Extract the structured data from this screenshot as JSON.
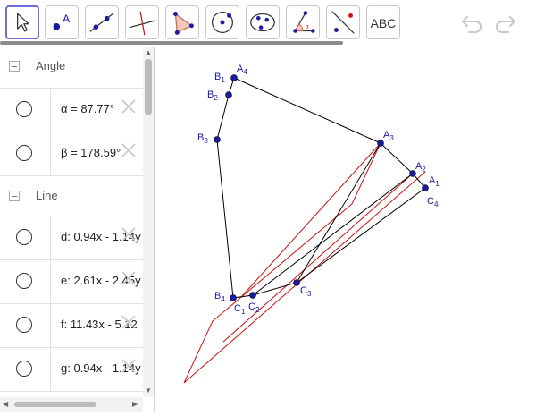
{
  "toolbar": {
    "abc_label": "ABC",
    "tools": [
      "move-tool",
      "point-tool",
      "line-tool",
      "perpendicular-tool",
      "polygon-tool",
      "circle-tool",
      "conic-tool",
      "angle-tool",
      "reflect-tool",
      "text-tool"
    ]
  },
  "algebra": {
    "groups": [
      {
        "label": "Angle"
      },
      {
        "label": "Line"
      }
    ],
    "rows": [
      {
        "expr": "α = 87.77°"
      },
      {
        "expr": "β = 178.59°"
      },
      {
        "expr": "d: 0.94x - 1.14y"
      },
      {
        "expr": "e: 2.61x - 2.45y"
      },
      {
        "expr": "f: 11.43x - 5.12"
      },
      {
        "expr": "g: 0.94x - 1.14y"
      }
    ]
  },
  "points": {
    "A4": {
      "base": "A",
      "sub": "4"
    },
    "B1": {
      "base": "B",
      "sub": "1"
    },
    "B2": {
      "base": "B",
      "sub": "2"
    },
    "B3": {
      "base": "B",
      "sub": "3"
    },
    "A3": {
      "base": "A",
      "sub": "3"
    },
    "A2": {
      "base": "A",
      "sub": "2"
    },
    "A1": {
      "base": "A",
      "sub": "1"
    },
    "C4": {
      "base": "C",
      "sub": "4"
    },
    "B4": {
      "base": "B",
      "sub": "4"
    },
    "C1": {
      "base": "C",
      "sub": "1"
    },
    "C2": {
      "base": "C",
      "sub": "2"
    },
    "C3": {
      "base": "C",
      "sub": "3"
    }
  },
  "colors": {
    "accent": "#6a6fd6",
    "point": "#1a1aa8",
    "polygon": "#000000",
    "red_lines": "#cc1111"
  }
}
